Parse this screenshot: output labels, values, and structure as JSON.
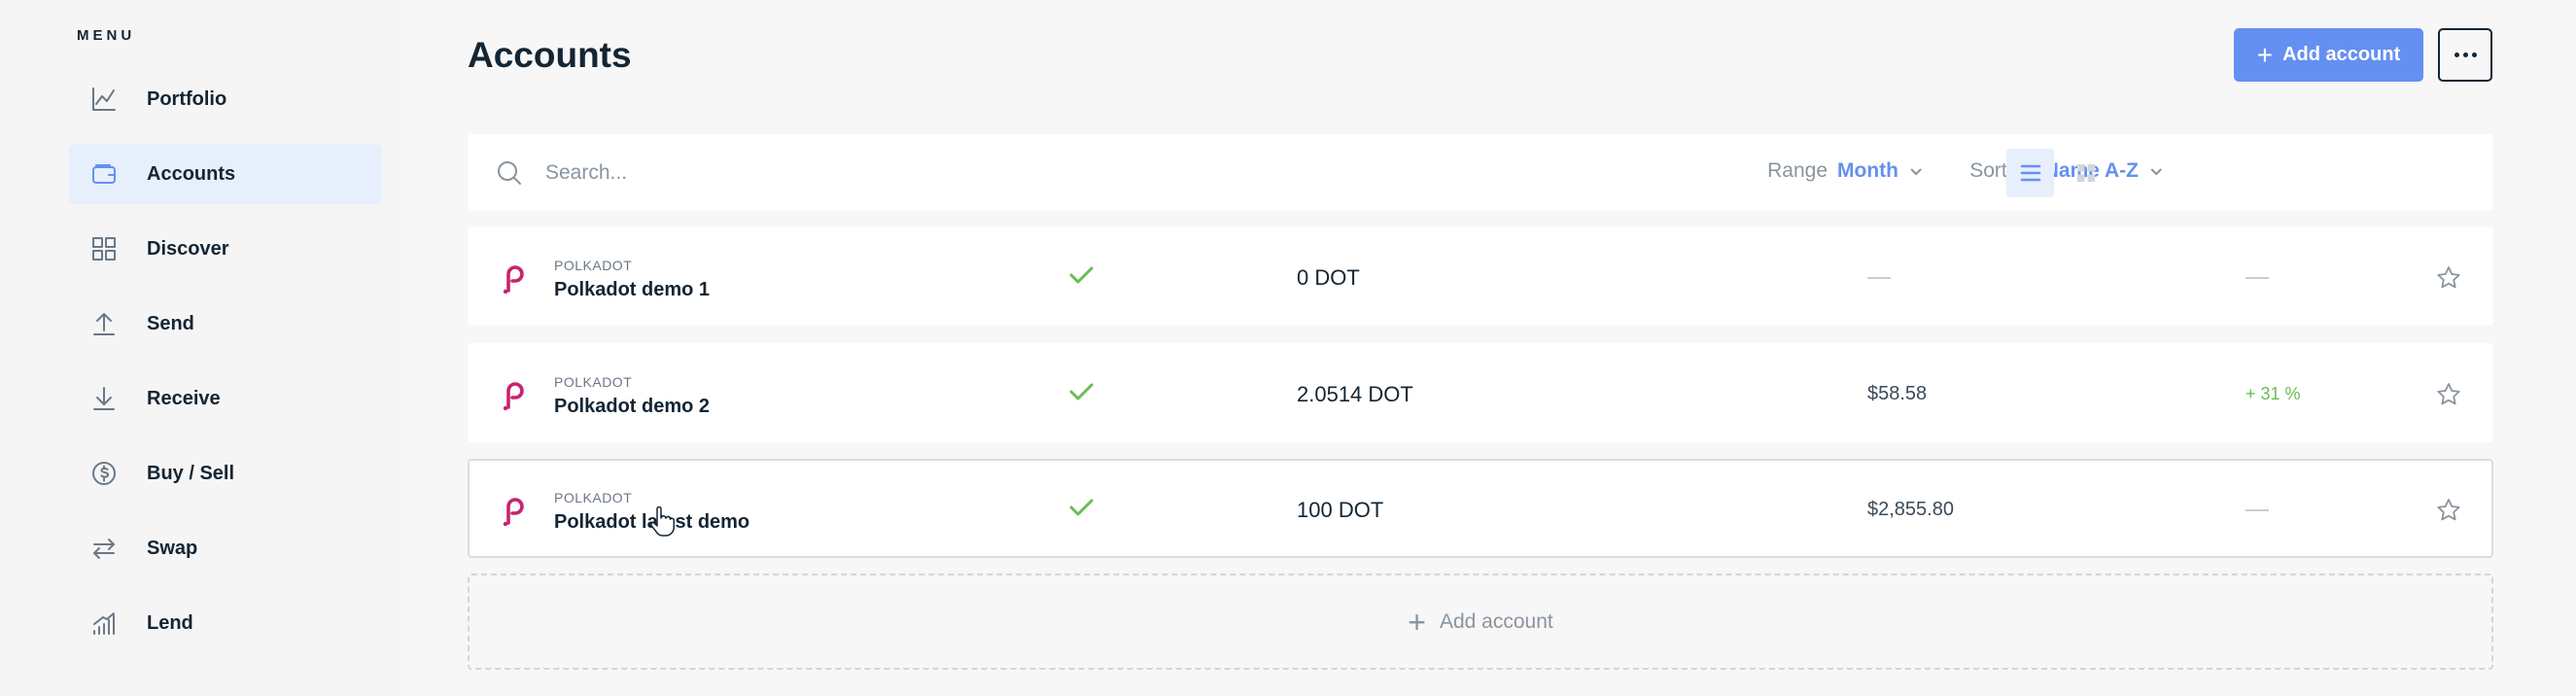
{
  "sidebar": {
    "menu_title": "MENU",
    "items": [
      {
        "label": "Portfolio",
        "icon": "chart-line-icon",
        "active": false
      },
      {
        "label": "Accounts",
        "icon": "wallet-icon",
        "active": true
      },
      {
        "label": "Discover",
        "icon": "grid-icon",
        "active": false
      },
      {
        "label": "Send",
        "icon": "arrow-up-icon",
        "active": false
      },
      {
        "label": "Receive",
        "icon": "arrow-down-icon",
        "active": false
      },
      {
        "label": "Buy / Sell",
        "icon": "dollar-circle-icon",
        "active": false
      },
      {
        "label": "Swap",
        "icon": "swap-icon",
        "active": false
      },
      {
        "label": "Lend",
        "icon": "bars-growth-icon",
        "active": false
      }
    ]
  },
  "header": {
    "title": "Accounts",
    "add_account_label": "Add account"
  },
  "toolbar": {
    "search_placeholder": "Search...",
    "range_label": "Range",
    "range_value": "Month",
    "sort_label": "Sort by",
    "sort_value": "Name A-Z"
  },
  "accounts": [
    {
      "ticker": "POLKADOT",
      "name": "Polkadot demo 1",
      "balance": "0 DOT",
      "fiat": "",
      "change": ""
    },
    {
      "ticker": "POLKADOT",
      "name": "Polkadot demo 2",
      "balance": "2.0514 DOT",
      "fiat": "$58.58",
      "change": "+ 31 %"
    },
    {
      "ticker": "POLKADOT",
      "name": "Polkadot latest demo",
      "balance": "100 DOT",
      "fiat": "$2,855.80",
      "change": ""
    }
  ],
  "add_row_label": "Add account",
  "colors": {
    "accent": "#6490f1",
    "polkadot": "#c8236f",
    "positive": "#66be54"
  }
}
